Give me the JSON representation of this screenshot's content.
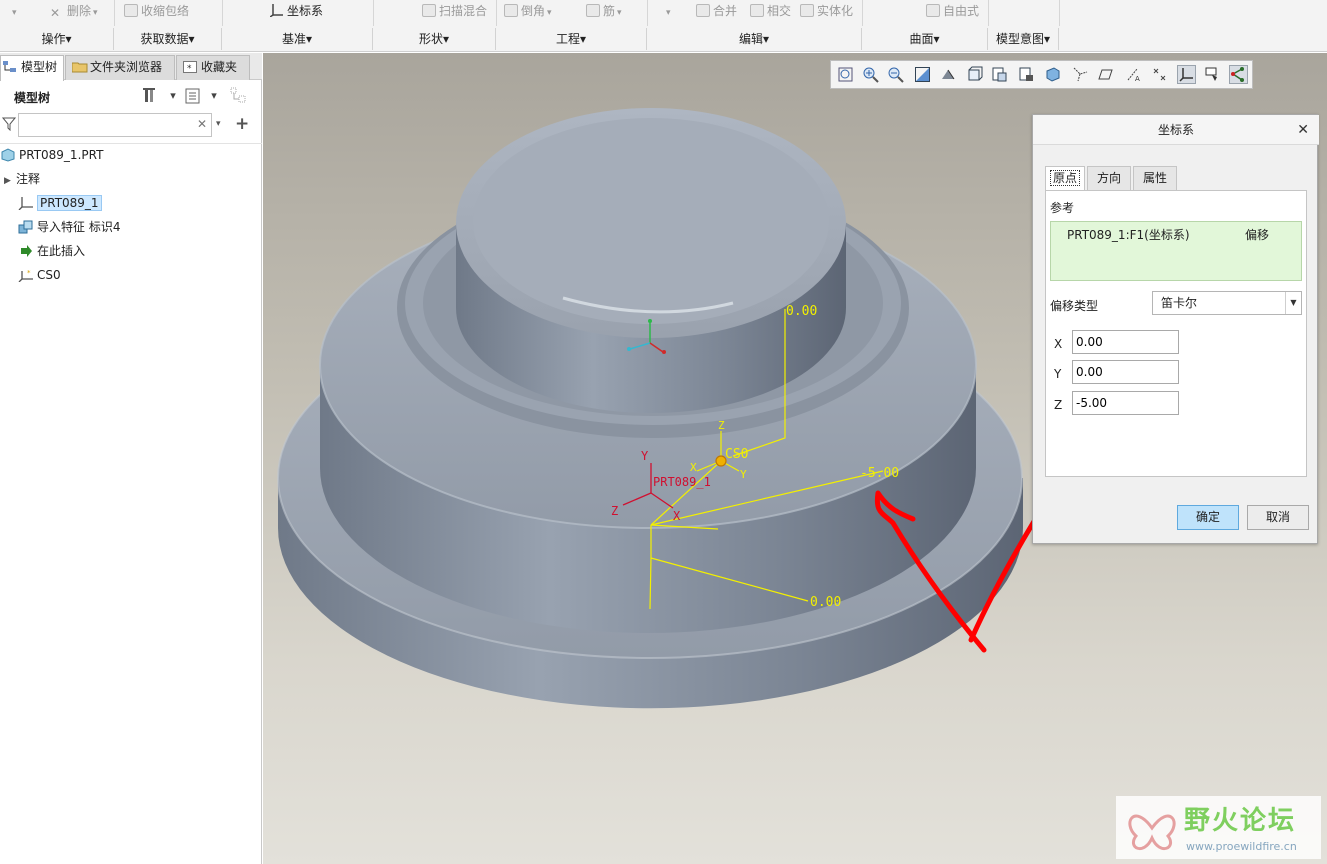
{
  "ribbon": {
    "items": [
      {
        "label": "删除",
        "x_hint": "delete"
      },
      {
        "label": "收缩包络"
      },
      {
        "label": "坐标系"
      },
      {
        "label": "扫描混合"
      },
      {
        "label": "倒角"
      },
      {
        "label": "筋"
      },
      {
        "label": "合并"
      },
      {
        "label": "相交"
      },
      {
        "label": "实体化"
      },
      {
        "label": "自由式"
      }
    ],
    "groups": [
      "操作",
      "获取数据",
      "基准",
      "形状",
      "工程",
      "编辑",
      "曲面",
      "模型意图"
    ]
  },
  "left_panel": {
    "tabs": [
      "模型树",
      "文件夹浏览器",
      "收藏夹"
    ],
    "tree_title": "模型树",
    "filter_placeholder": "",
    "items": [
      {
        "label": "PRT089_1.PRT"
      },
      {
        "label": "注释"
      },
      {
        "label": "PRT089_1"
      },
      {
        "label": "导入特征 标识4"
      },
      {
        "label": "在此插入"
      },
      {
        "label": "CS0"
      }
    ]
  },
  "viewport": {
    "annotations": {
      "dim_top": "0.00",
      "dim_right": "-5.00",
      "dim_bottom": "0.00",
      "cs_name": "CS0",
      "ref_name": "PRT089_1",
      "axis_x": "X",
      "axis_y": "Y",
      "axis_z": "Z"
    },
    "colors": {
      "model": "#8d97a5",
      "highlight": "#ffff33",
      "csys_red": "#d01030",
      "arrow": "#ff0000"
    }
  },
  "dialog": {
    "title": "坐标系",
    "tabs": [
      "原点",
      "方向",
      "属性"
    ],
    "ref_label": "参考",
    "ref_name": "PRT089_1:F1(坐标系)",
    "ref_type": "偏移",
    "offset_type_label": "偏移类型",
    "offset_type_value": "笛卡尔",
    "x_label": "X",
    "y_label": "Y",
    "z_label": "Z",
    "x_value": "0.00",
    "y_value": "0.00",
    "z_value": "-5.00",
    "ok_label": "确定",
    "cancel_label": "取消"
  },
  "watermark": {
    "title": "野火论坛",
    "url": "www.proewildfire.cn"
  }
}
